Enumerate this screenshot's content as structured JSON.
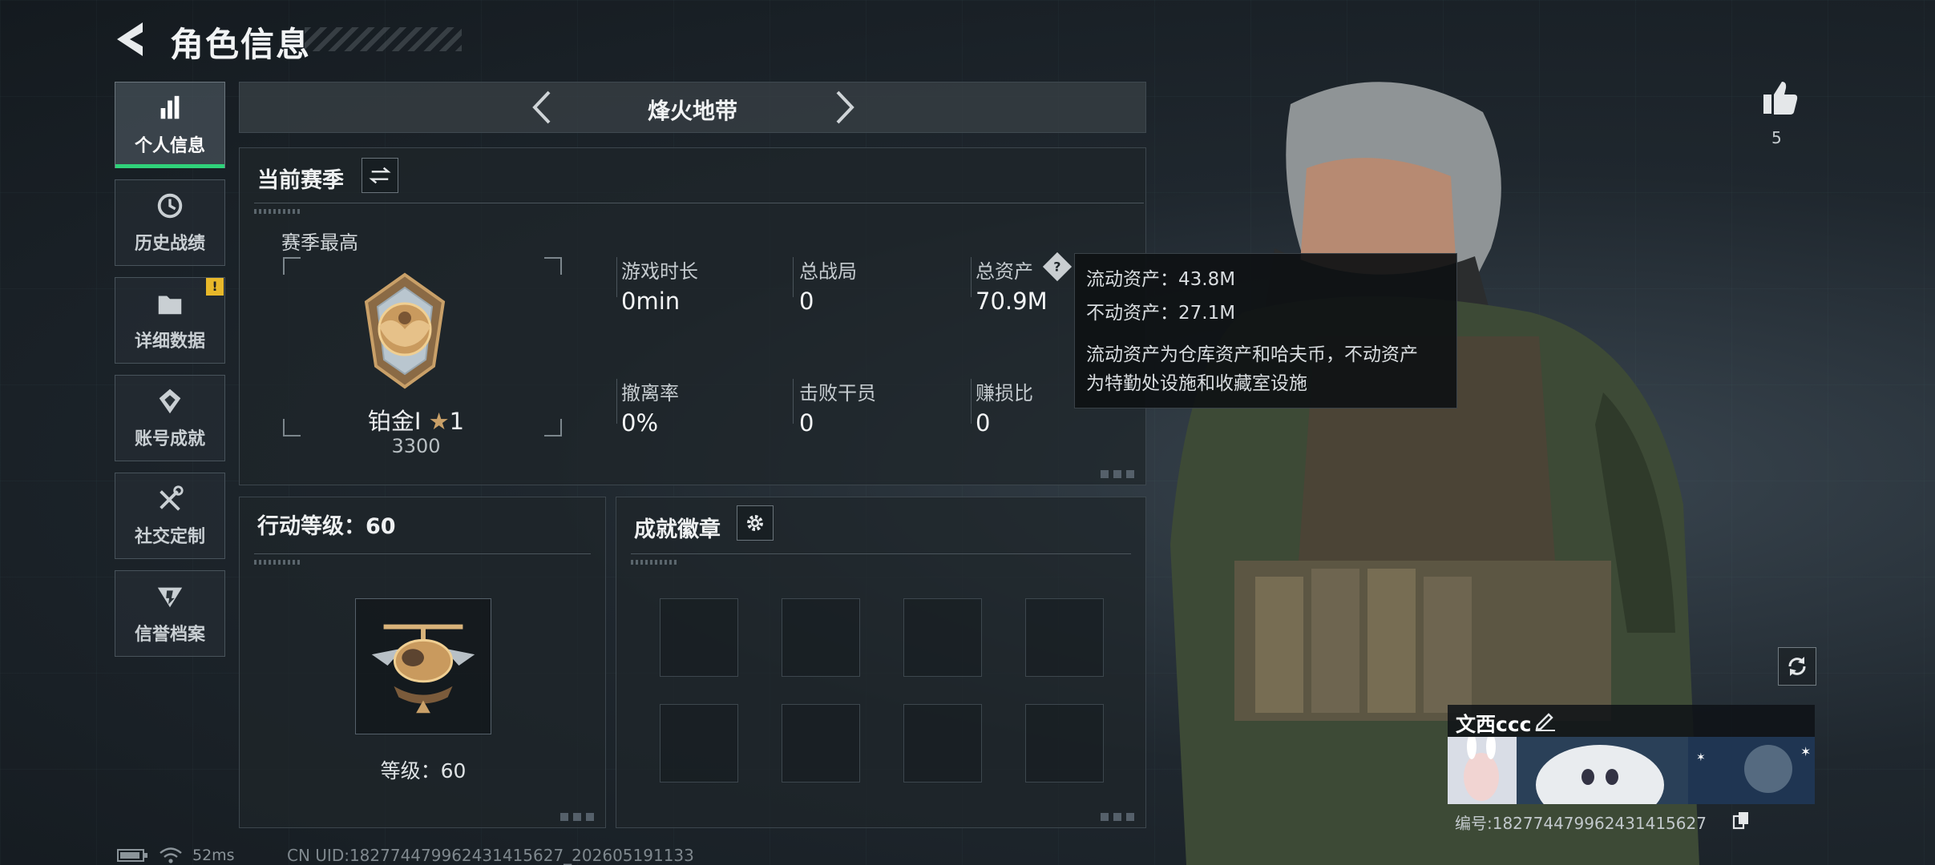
{
  "header": {
    "title": "角色信息"
  },
  "sidebar": {
    "items": [
      {
        "label": "个人信息",
        "icon": "bar-chart-icon",
        "active": true
      },
      {
        "label": "历史战绩",
        "icon": "clock-history-icon"
      },
      {
        "label": "详细数据",
        "icon": "folder-icon",
        "badge": "!"
      },
      {
        "label": "账号成就",
        "icon": "medal-icon"
      },
      {
        "label": "社交定制",
        "icon": "tools-icon"
      },
      {
        "label": "信誉档案",
        "icon": "credibility-icon"
      }
    ]
  },
  "mode": {
    "title": "烽火地带"
  },
  "season": {
    "title": "当前赛季",
    "best_label": "赛季最高",
    "rank_name": "铂金I",
    "rank_stars": "1",
    "rank_points": "3300",
    "stats": [
      {
        "label": "游戏时长",
        "value": "0min"
      },
      {
        "label": "总战局",
        "value": "0"
      },
      {
        "label": "总资产",
        "value": "70.9M"
      },
      {
        "label": "撤离率",
        "value": "0%"
      },
      {
        "label": "击败干员",
        "value": "0"
      },
      {
        "label": "赚损比",
        "value": "0"
      }
    ]
  },
  "tooltip": {
    "liquid": "流动资产：43.8M",
    "fixed": "不动资产：27.1M",
    "desc_line1": "流动资产为仓库资产和哈夫币，不动资产",
    "desc_line2": "为特勤处设施和收藏室设施"
  },
  "action_level": {
    "title": "行动等级：60",
    "level_text": "等级：60"
  },
  "achievements": {
    "title": "成就徽章",
    "slot_count": 8
  },
  "profile": {
    "likes": "5",
    "name": "文西ccc",
    "id_text": "编号:18277447996243141562​7"
  },
  "status": {
    "ping": "52ms",
    "uid": "CN UID:18277447996243141562​7_202605191133"
  },
  "colors": {
    "accent_green": "#2fd27a",
    "warning": "#e8b82a",
    "rank_gold": "#c9a068"
  }
}
